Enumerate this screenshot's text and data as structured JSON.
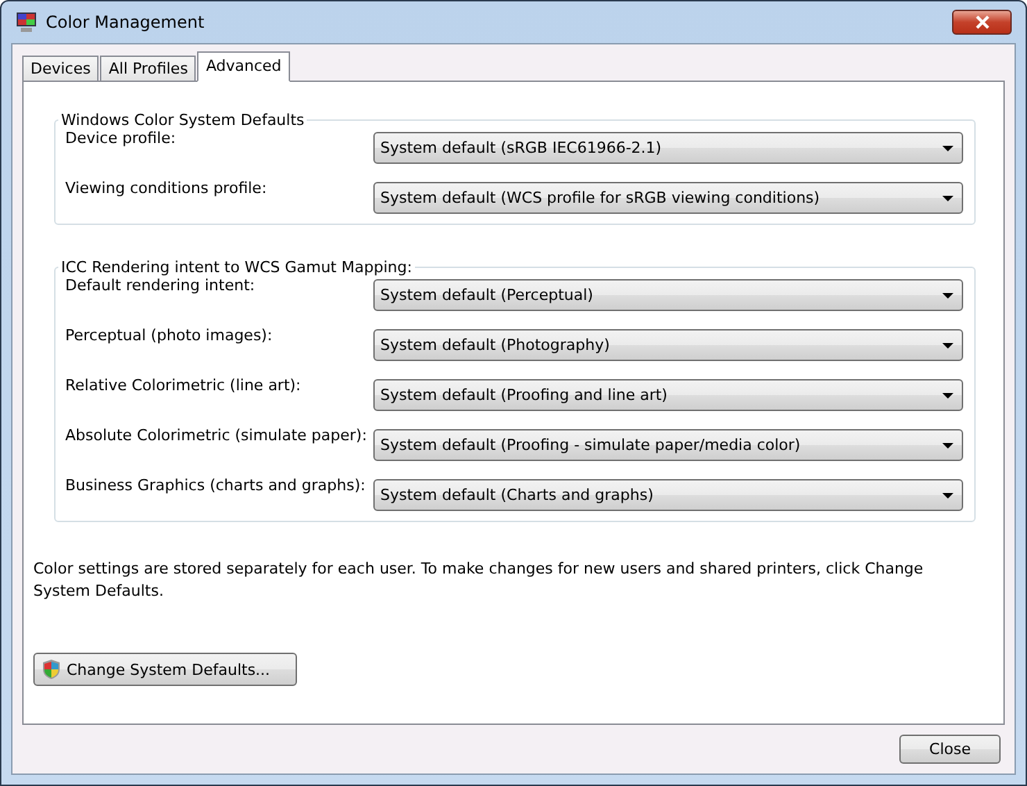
{
  "window": {
    "title": "Color Management"
  },
  "tabs": [
    {
      "label": "Devices",
      "selected": false
    },
    {
      "label": "All Profiles",
      "selected": false
    },
    {
      "label": "Advanced",
      "selected": true
    }
  ],
  "groups": [
    {
      "title": "Windows Color System Defaults",
      "rows": [
        {
          "label": "Device profile:",
          "value": "System default (sRGB IEC61966-2.1)"
        },
        {
          "label": "Viewing conditions profile:",
          "value": "System default (WCS profile for sRGB viewing conditions)"
        }
      ]
    },
    {
      "title": "ICC Rendering intent to WCS Gamut Mapping:",
      "rows": [
        {
          "label": "Default rendering intent:",
          "value": "System default (Perceptual)"
        },
        {
          "label": "Perceptual (photo images):",
          "value": "System default (Photography)"
        },
        {
          "label": "Relative Colorimetric (line art):",
          "value": "System default (Proofing and line art)"
        },
        {
          "label": "Absolute Colorimetric (simulate paper):",
          "value": "System default (Proofing - simulate paper/media color)"
        },
        {
          "label": "Business Graphics (charts and graphs):",
          "value": "System default (Charts and graphs)"
        }
      ]
    }
  ],
  "note": "Color settings are stored separately for each user. To make changes for new users and shared printers, click Change System Defaults.",
  "change_button": "Change System Defaults...",
  "close_button": "Close"
}
